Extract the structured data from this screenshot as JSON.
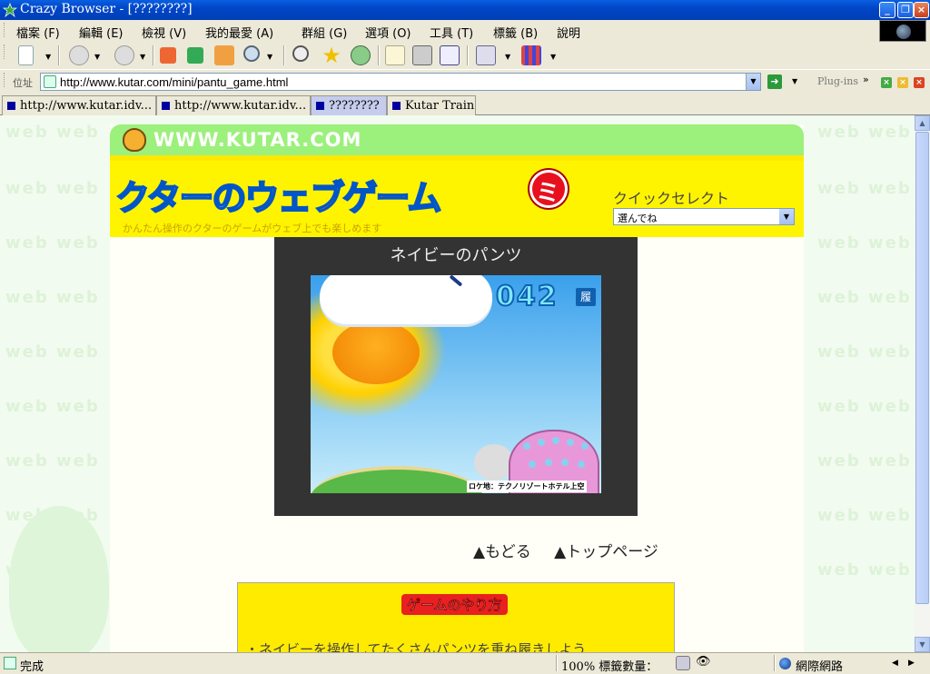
{
  "window": {
    "title": "Crazy Browser - [????????]"
  },
  "menu": {
    "items": [
      "檔案 (F)",
      "編輯 (E)",
      "檢視 (V)",
      "我的最愛 (A)",
      "群組 (G)",
      "選項 (O)",
      "工具 (T)",
      "標籤 (B)",
      "說明"
    ]
  },
  "address": {
    "label": "位址",
    "url": "http://www.kutar.com/mini/pantu_game.html",
    "plugins_label": "Plug-ins"
  },
  "tabs": [
    {
      "label": "http://www.kutar.idv...",
      "active": false
    },
    {
      "label": "http://www.kutar.idv...",
      "active": false
    },
    {
      "label": "????????",
      "active": true
    },
    {
      "label": "Kutar Train",
      "active": false
    }
  ],
  "site": {
    "domain": "WWW.KUTAR.COM",
    "banner_title_part1": "クターの",
    "banner_title_part2": "ウェブゲーム",
    "banner_mark": "ミ",
    "banner_subtitle": "かんたん操作のクターのゲームがウェブ上でも楽しめます",
    "quick_select_label": "クイックセレクト",
    "quick_select_value": "選んでね",
    "bg_word": "web web"
  },
  "game": {
    "title": "ネイビーのパンツ",
    "counter": "042",
    "counter_unit": "履",
    "location": "ロケ地：テクノリゾートホテル上空"
  },
  "nav": {
    "back": "▲もどる",
    "top": "▲トップページ"
  },
  "howto": {
    "title": "ゲームのやり方",
    "line1": "・ネイビーを操作してたくさんパンツを重ね履きしよう"
  },
  "status": {
    "text": "完成",
    "zoom": "100% 標籤數量：",
    "zone": "網際網路"
  },
  "colors": {
    "titlebar": "#0046c8",
    "site_header": "#9cf07c",
    "banner_yellow": "#fff400",
    "game_frame": "#333333"
  }
}
